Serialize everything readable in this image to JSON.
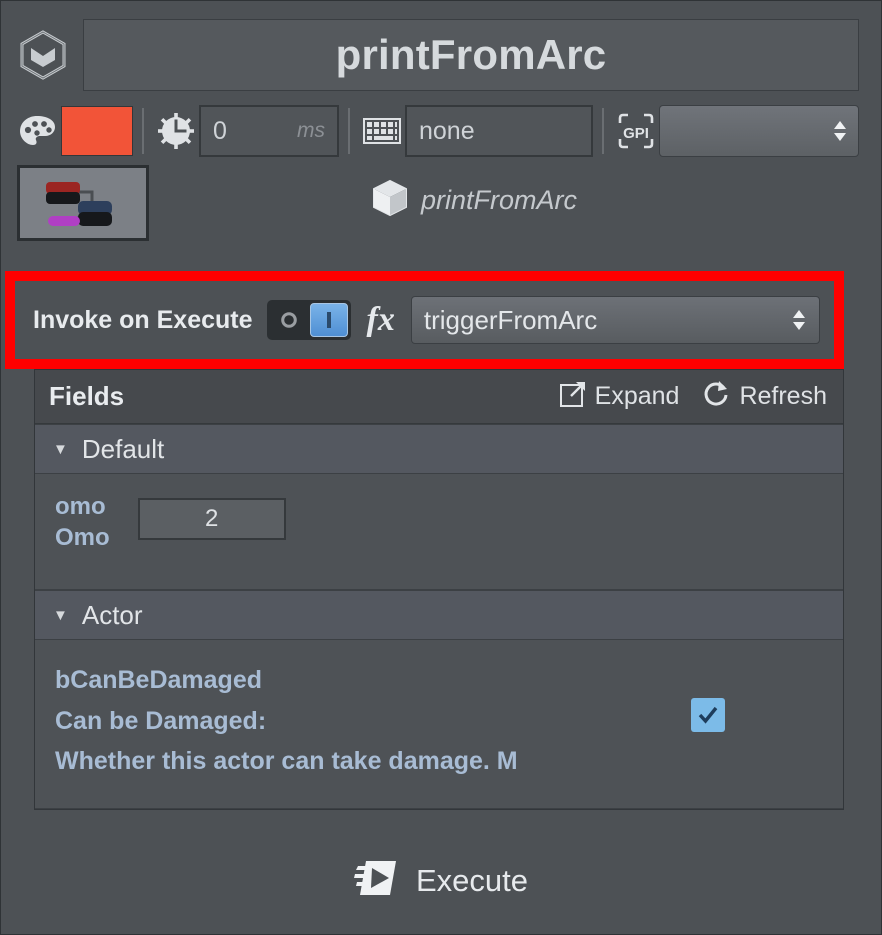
{
  "window": {
    "logo_icon": "hex-cube-logo-icon",
    "title": "printFromArc"
  },
  "toolbar": {
    "palette_icon": "palette-icon",
    "color_swatch": "#f25438",
    "clock_icon": "clock-icon",
    "delay": {
      "value": "0",
      "unit": "ms"
    },
    "keyboard_icon": "keyboard-icon",
    "shortcut": {
      "value": "none"
    },
    "gpi_icon": "gpi-icon",
    "gpi_select": {
      "value": ""
    }
  },
  "node": {
    "thumbnail_icon": "node-graph-thumbnail",
    "cube_icon": "cube-icon",
    "name": "printFromArc"
  },
  "invoke": {
    "label": "Invoke on Execute",
    "toggle": {
      "off_label": "O",
      "on_label": "I",
      "state": "on"
    },
    "fx_icon": "fx-icon",
    "function": "triggerFromArc",
    "highlight_color": "#ff0000"
  },
  "fields": {
    "title": "Fields",
    "expand": {
      "label": "Expand",
      "icon": "expand-icon"
    },
    "refresh": {
      "label": "Refresh",
      "icon": "refresh-icon"
    },
    "sections": [
      {
        "name": "Default",
        "caret": "▼",
        "property": {
          "name": "omo",
          "display_name": "Omo",
          "value": "2"
        }
      },
      {
        "name": "Actor",
        "caret": "▼",
        "property": {
          "name": "bCanBeDamaged",
          "display_name": "Can be Damaged:",
          "description": "Whether this actor can take damage. M",
          "checked": true
        }
      }
    ]
  },
  "footer": {
    "execute": {
      "label": "Execute",
      "icon": "fast-play-icon"
    }
  }
}
